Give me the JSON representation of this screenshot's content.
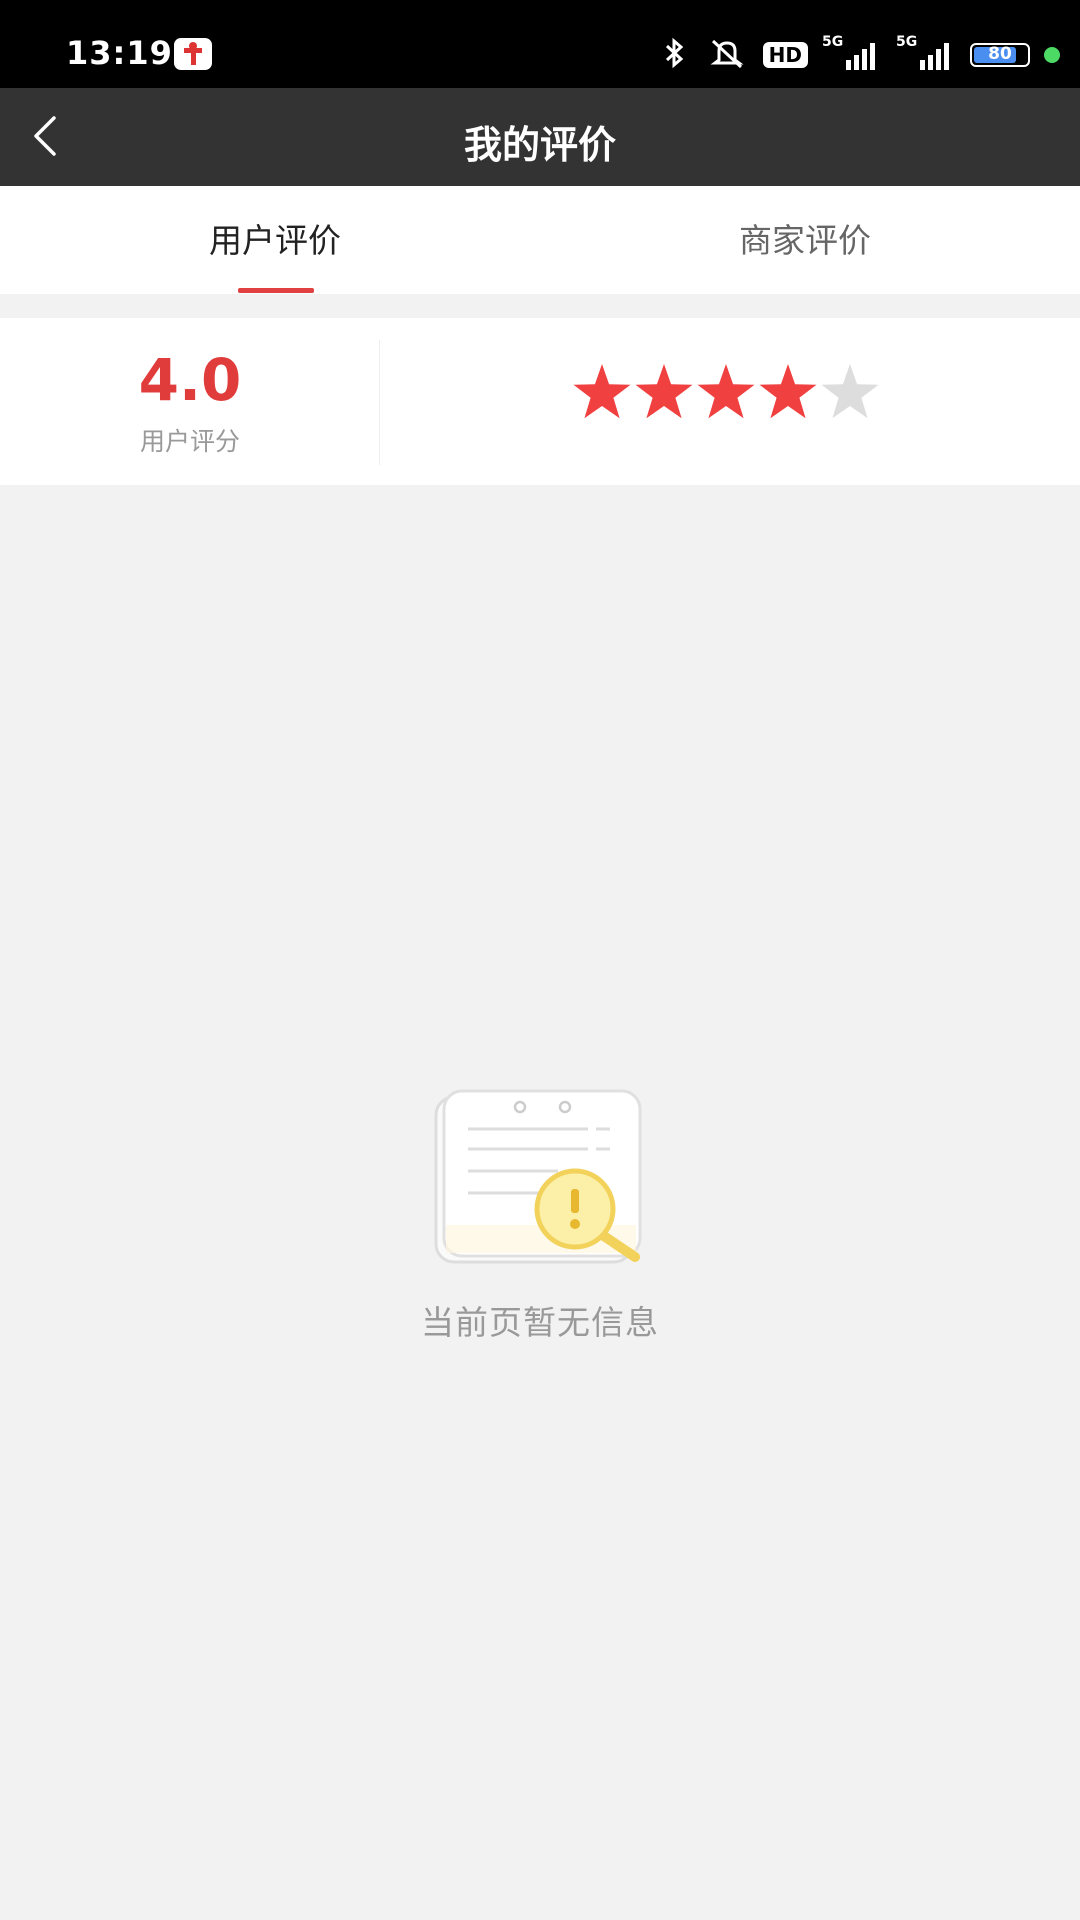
{
  "status_bar": {
    "time": "13:19",
    "hd_label": "HD",
    "signal_1_label": "5G",
    "signal_2_label": "5G",
    "battery_level": "80",
    "battery_fraction": 0.8
  },
  "header": {
    "title": "我的评价"
  },
  "tabs": [
    {
      "label": "用户评价",
      "active": true
    },
    {
      "label": "商家评价",
      "active": false
    }
  ],
  "rating": {
    "score": "4.0",
    "label": "用户评分",
    "stars_filled": 4,
    "stars_total": 5,
    "star_color": "#f04040",
    "star_empty_color": "#dddddd"
  },
  "empty_state": {
    "message": "当前页暂无信息"
  },
  "colors": {
    "accent": "#e04040",
    "nav_background": "#333333"
  }
}
